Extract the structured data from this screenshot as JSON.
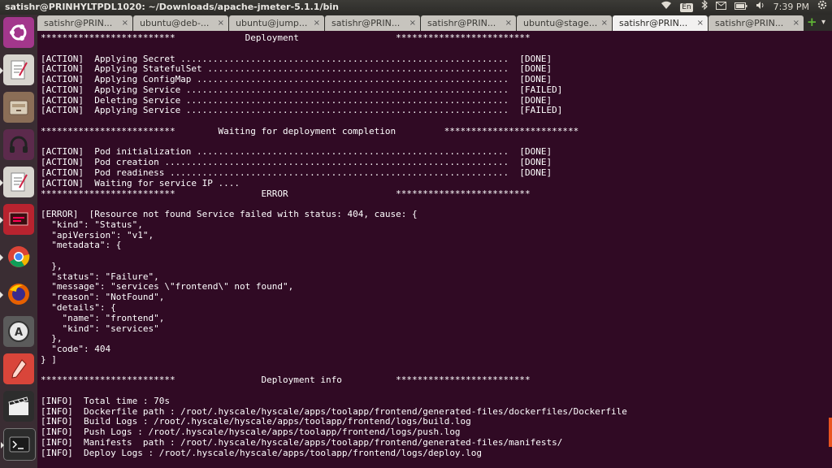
{
  "window": {
    "title": "satishr@PRINHYLTPDL1020: ~/Downloads/apache-jmeter-5.1.1/bin"
  },
  "panel": {
    "keyboard": "En",
    "time": "7:39 PM"
  },
  "launcher": {
    "icons": [
      "ubuntu-logo-icon",
      "text-editor-icon",
      "file-manager-icon",
      "headphones-icon",
      "text-editor-icon",
      "presentation-app-icon",
      "chrome-icon",
      "firefox-icon",
      "software-updater-icon",
      "pen-tool-icon",
      "video-editor-icon",
      "terminal-icon"
    ]
  },
  "tabs": [
    {
      "label": "satishr@PRIN...",
      "close": "×"
    },
    {
      "label": "ubuntu@deb-...",
      "close": "×"
    },
    {
      "label": "ubuntu@jump...",
      "close": "×"
    },
    {
      "label": "satishr@PRIN...",
      "close": "×"
    },
    {
      "label": "satishr@PRIN...",
      "close": "×"
    },
    {
      "label": "ubuntu@stage...",
      "close": "×"
    },
    {
      "label": "satishr@PRIN...",
      "close": "×"
    },
    {
      "label": "satishr@PRIN...",
      "close": "×"
    }
  ],
  "tab_add": "+",
  "tab_menu": "▾",
  "terminal": {
    "lines": [
      "*************************             Deployment                  *************************",
      "",
      "[ACTION]  Applying Secret .............................................................  [DONE]",
      "[ACTION]  Applying StatefulSet ........................................................  [DONE]",
      "[ACTION]  Applying ConfigMap ..........................................................  [DONE]",
      "[ACTION]  Applying Service ............................................................  [FAILED]",
      "[ACTION]  Deleting Service ............................................................  [DONE]",
      "[ACTION]  Applying Service ............................................................  [FAILED]",
      "",
      "*************************        Waiting for deployment completion         *************************",
      "",
      "[ACTION]  Pod initialization ..........................................................  [DONE]",
      "[ACTION]  Pod creation ................................................................  [DONE]",
      "[ACTION]  Pod readiness ...............................................................  [DONE]",
      "[ACTION]  Waiting for service IP ....",
      "*************************                ERROR                    *************************",
      "",
      "[ERROR]  [Resource not found Service failed with status: 404, cause: {",
      "  \"kind\": \"Status\",",
      "  \"apiVersion\": \"v1\",",
      "  \"metadata\": {",
      "",
      "  },",
      "  \"status\": \"Failure\",",
      "  \"message\": \"services \\\"frontend\\\" not found\",",
      "  \"reason\": \"NotFound\",",
      "  \"details\": {",
      "    \"name\": \"frontend\",",
      "    \"kind\": \"services\"",
      "  },",
      "  \"code\": 404",
      "} ]",
      "",
      "*************************                Deployment info          *************************",
      "",
      "[INFO]  Total time : 70s",
      "[INFO]  Dockerfile path : /root/.hyscale/hyscale/apps/toolapp/frontend/generated-files/dockerfiles/Dockerfile",
      "[INFO]  Build Logs : /root/.hyscale/hyscale/apps/toolapp/frontend/logs/build.log",
      "[INFO]  Push Logs : /root/.hyscale/hyscale/apps/toolapp/frontend/logs/push.log",
      "[INFO]  Manifests  path : /root/.hyscale/hyscale/apps/toolapp/frontend/generated-files/manifests/",
      "[INFO]  Deploy Logs : /root/.hyscale/hyscale/apps/toolapp/frontend/logs/deploy.log"
    ]
  },
  "colors": {
    "terminal_bg": "#300a24",
    "accent": "#e95420"
  }
}
